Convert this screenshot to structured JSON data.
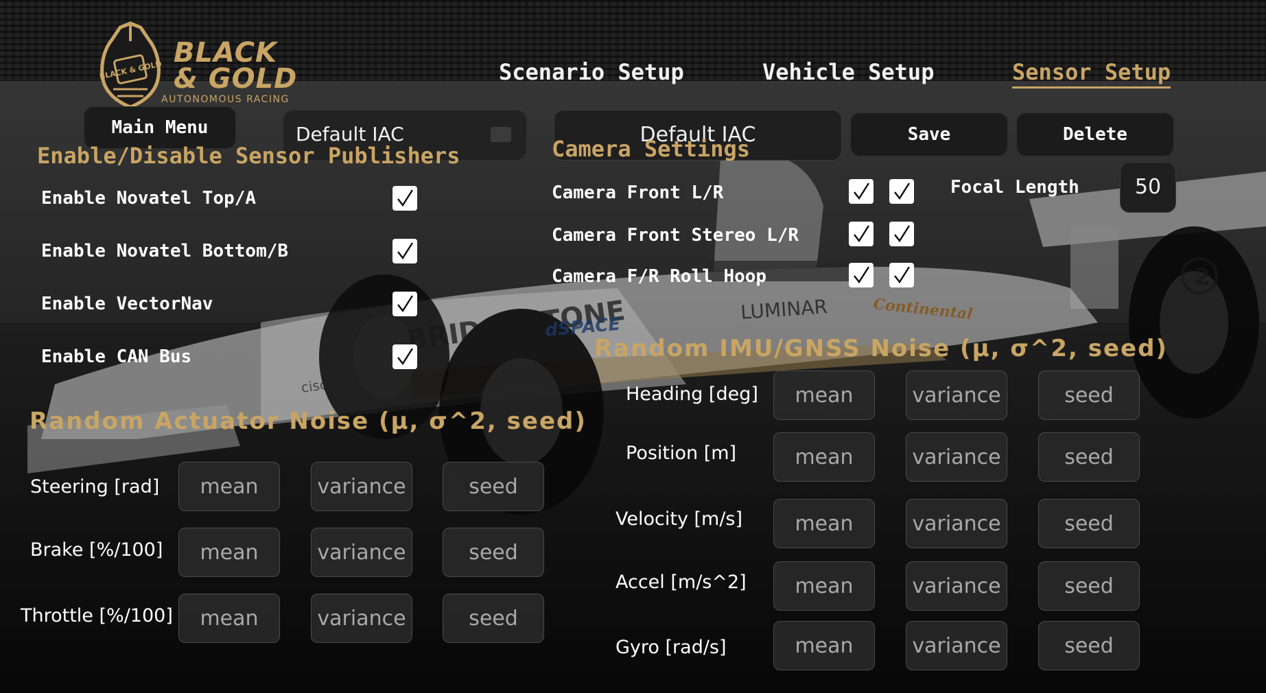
{
  "brand": {
    "word_line1": "BLACK",
    "word_line2": "& GOLD",
    "subtitle": "AUTONOMOUS RACING",
    "badge_text": "BLACK & GOLD"
  },
  "nav": {
    "scenario": "Scenario Setup",
    "vehicle": "Vehicle Setup",
    "sensor": "Sensor Setup",
    "active": "sensor"
  },
  "toolbar": {
    "main_menu": "Main Menu",
    "preset_dropdown": "Default IAC",
    "config_name": "Default IAC",
    "save": "Save",
    "delete": "Delete"
  },
  "publishers": {
    "title": "Enable/Disable Sensor Publishers",
    "items": [
      {
        "label": "Enable Novatel Top/A",
        "checked": true
      },
      {
        "label": "Enable Novatel Bottom/B",
        "checked": true
      },
      {
        "label": "Enable VectorNav",
        "checked": true
      },
      {
        "label": "Enable CAN Bus",
        "checked": true
      }
    ]
  },
  "camera": {
    "title": "Camera Settings",
    "rows": [
      {
        "label": "Camera Front L/R",
        "left": true,
        "right": true
      },
      {
        "label": "Camera Front Stereo L/R",
        "left": true,
        "right": true
      },
      {
        "label": "Camera F/R Roll Hoop",
        "left": true,
        "right": true
      }
    ],
    "focal_label": "Focal Length",
    "focal_value": "50"
  },
  "actuator_noise": {
    "title": "Random Actuator Noise (μ, σ^2, seed)",
    "rows": [
      {
        "label": "Steering [rad]",
        "mean": "mean",
        "variance": "variance",
        "seed": "seed"
      },
      {
        "label": "Brake [%/100]",
        "mean": "mean",
        "variance": "variance",
        "seed": "seed"
      },
      {
        "label": "Throttle [%/100]",
        "mean": "mean",
        "variance": "variance",
        "seed": "seed"
      }
    ]
  },
  "imu_noise": {
    "title": "Random IMU/GNSS Noise (μ, σ^2, seed)",
    "rows": [
      {
        "label": "Heading [deg]",
        "mean": "mean",
        "variance": "variance",
        "seed": "seed"
      },
      {
        "label": "Position [m]",
        "mean": "mean",
        "variance": "variance",
        "seed": "seed"
      },
      {
        "label": "Velocity [m/s]",
        "mean": "mean",
        "variance": "variance",
        "seed": "seed"
      },
      {
        "label": "Accel [m/s^2]",
        "mean": "mean",
        "variance": "variance",
        "seed": "seed"
      },
      {
        "label": "Gyro [rad/s]",
        "mean": "mean",
        "variance": "variance",
        "seed": "seed"
      }
    ]
  },
  "background_text": {
    "tire_brand": "BRIDGESTONE",
    "sponsor1": "dSPACE",
    "sponsor2": "LUMINAR",
    "sponsor3": "Continental",
    "sponsor4": "cisco",
    "car_number": "2"
  },
  "colors": {
    "accent_gold": "#c9a564",
    "panel_dark": "#1b1b1b",
    "text_white": "#ffffff"
  }
}
